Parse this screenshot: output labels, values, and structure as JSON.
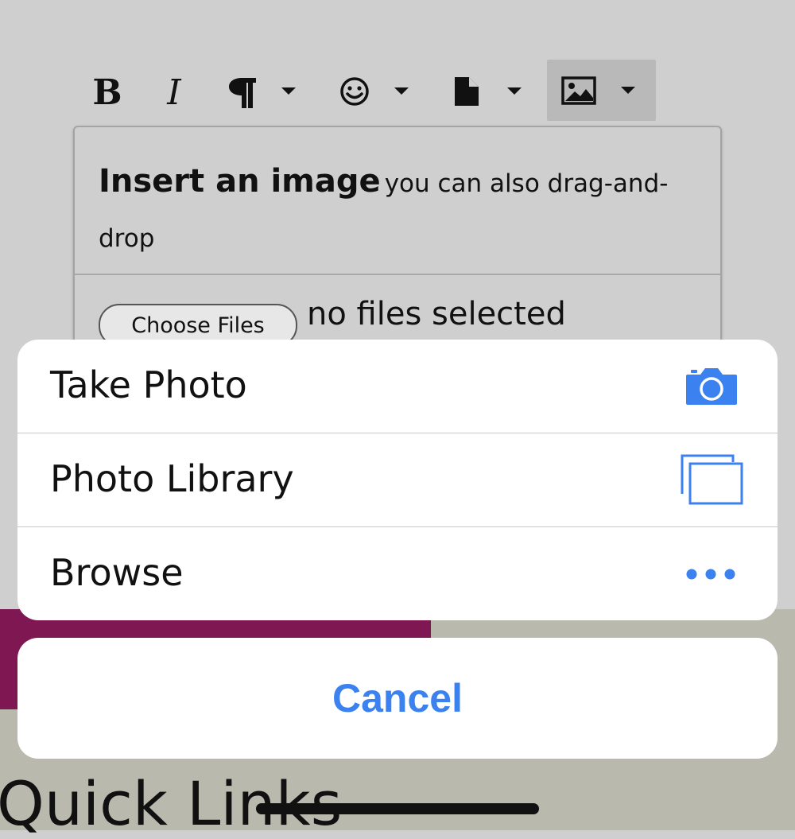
{
  "toolbar": {
    "bold_label": "B",
    "italic_label": "I",
    "icons": [
      "paragraph-icon",
      "emoji-icon",
      "file-icon",
      "image-icon"
    ]
  },
  "dialog": {
    "title": "Insert an image",
    "subtitle": "you can also drag-and-drop",
    "choose_files_label": "Choose Files",
    "file_status": "no files selected"
  },
  "action_sheet": {
    "items": [
      {
        "label": "Take Photo",
        "icon": "camera-icon"
      },
      {
        "label": "Photo Library",
        "icon": "photo-library-icon"
      },
      {
        "label": "Browse",
        "icon": "more-dots-icon"
      }
    ],
    "cancel_label": "Cancel"
  },
  "page": {
    "heading": "Quick Links"
  },
  "colors": {
    "ios_blue": "#3b82f0",
    "accent_magenta": "#7f1753",
    "olive_bg": "#b9b9ae"
  }
}
